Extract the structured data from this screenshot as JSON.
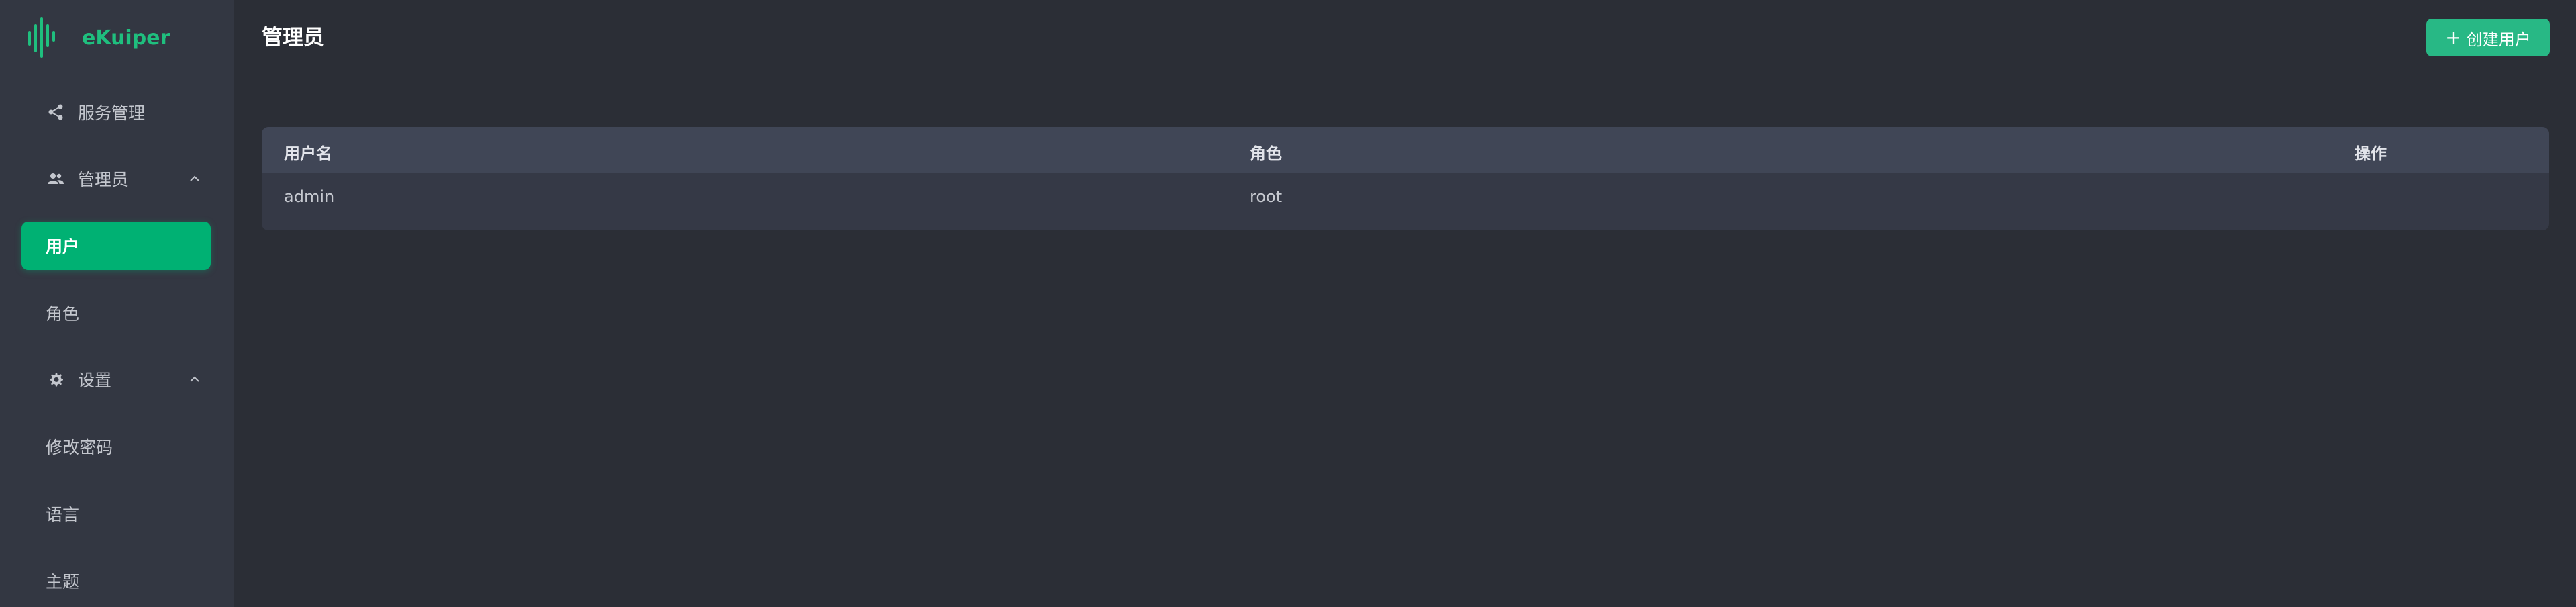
{
  "app": {
    "name": "eKuiper",
    "brand_color": "#1fbf7e",
    "accent_color": "#00b173",
    "background_color": "#2b2e36",
    "sidebar_color": "#333742"
  },
  "sidebar": {
    "items": [
      {
        "label": "服务管理",
        "icon": "share-icon"
      },
      {
        "label": "管理员",
        "icon": "users-icon",
        "expanded": true,
        "children": [
          {
            "label": "用户",
            "active": true
          },
          {
            "label": "角色",
            "active": false
          }
        ]
      },
      {
        "label": "设置",
        "icon": "gear-icon",
        "expanded": true,
        "children": [
          {
            "label": "修改密码"
          },
          {
            "label": "语言"
          },
          {
            "label": "主题"
          }
        ]
      }
    ]
  },
  "page": {
    "title": "管理员",
    "create_button_label": "创建用户",
    "create_button_icon": "plus-icon"
  },
  "table": {
    "columns": [
      "用户名",
      "角色",
      "操作"
    ],
    "rows": [
      {
        "username": "admin",
        "role": "root",
        "actions": ""
      }
    ]
  }
}
